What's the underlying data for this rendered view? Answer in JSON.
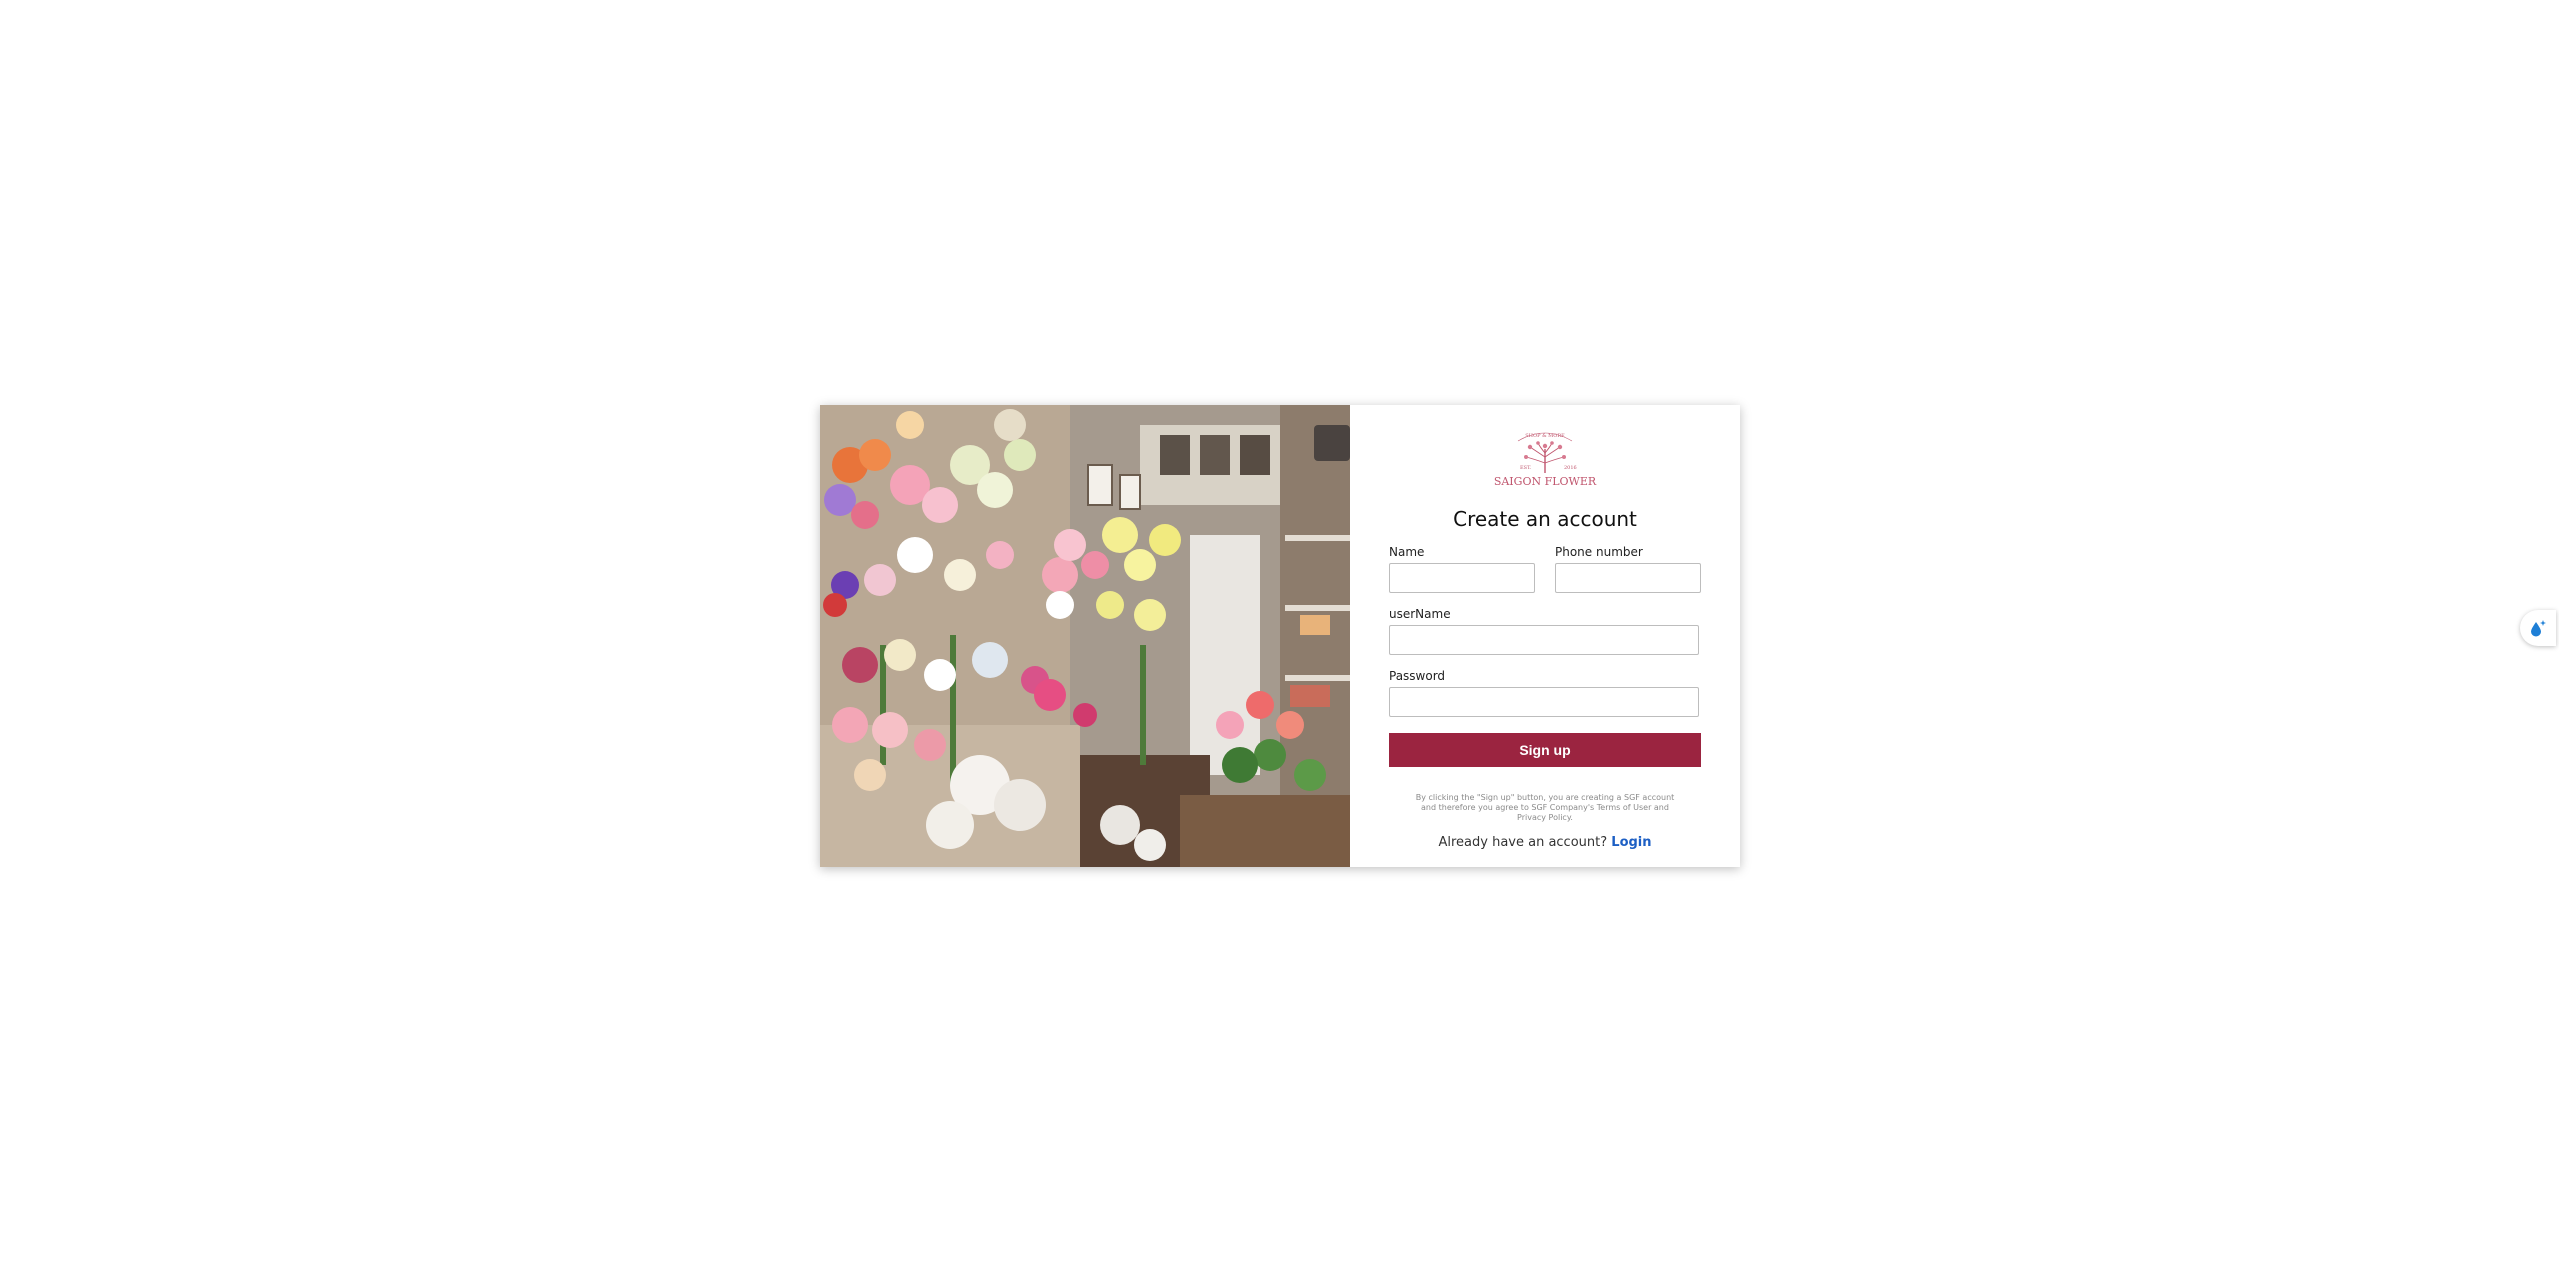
{
  "brand": {
    "logo_top_text": "SHOP & MORE",
    "logo_est": "EST.",
    "logo_year": "2016",
    "logo_name": "SAIGON FLOWER"
  },
  "form": {
    "title": "Create an account",
    "name_label": "Name",
    "phone_label": "Phone number",
    "username_label": "userName",
    "password_label": "Password",
    "name_value": "",
    "phone_value": "",
    "username_value": "",
    "password_value": "",
    "signup_label": "Sign up",
    "terms_text": "By clicking the \"Sign up\" button, you are creating a SGF account and therefore you agree to SGF Company's Terms of User and Privacy Policy.",
    "login_prompt": "Already have an account?",
    "login_label": "Login"
  },
  "colors": {
    "accent": "#9b2440",
    "link": "#1d5fc4",
    "logo": "#c0566e"
  },
  "widget": {
    "icon": "water-drop-sparkle-icon"
  }
}
